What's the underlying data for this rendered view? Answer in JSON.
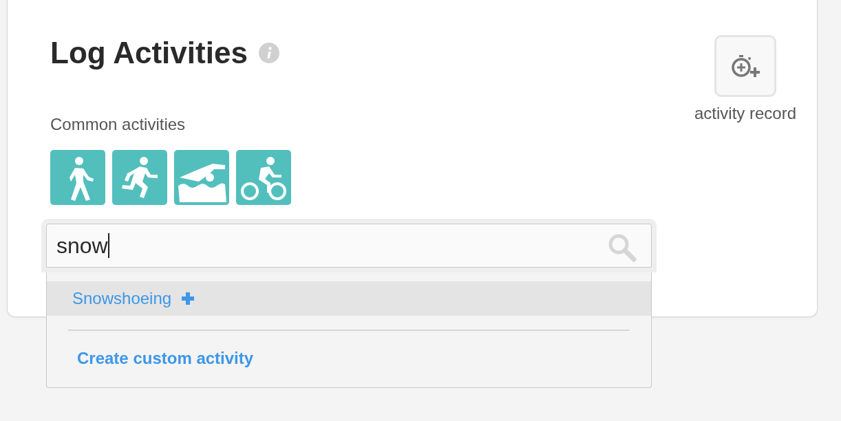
{
  "header": {
    "title": "Log Activities"
  },
  "record_button": {
    "label": "activity record"
  },
  "common": {
    "label": "Common activities",
    "activities": [
      {
        "kind": "walk"
      },
      {
        "kind": "run"
      },
      {
        "kind": "swim"
      },
      {
        "kind": "bike"
      }
    ]
  },
  "search": {
    "value": "snow"
  },
  "suggestions": [
    {
      "label": "Snowshoeing",
      "selected": true
    }
  ],
  "create_link": "Create custom activity"
}
